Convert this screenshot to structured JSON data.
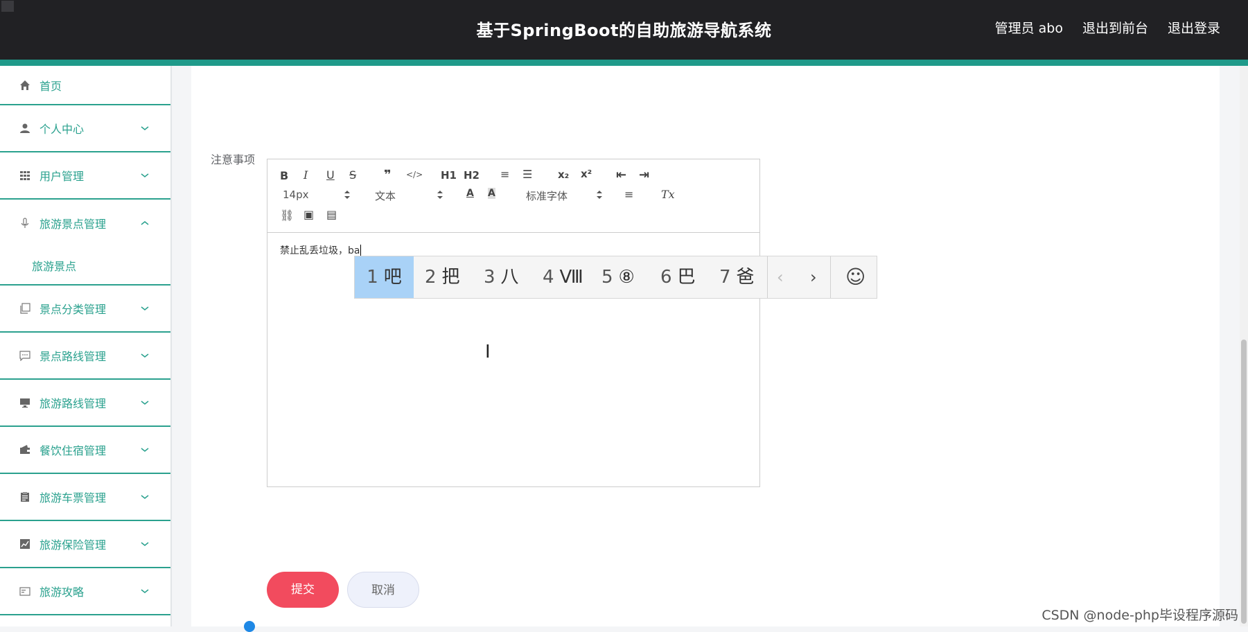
{
  "header": {
    "title": "基于SpringBoot的自助旅游导航系统",
    "links": [
      "管理员 abo",
      "退出到前台",
      "退出登录"
    ],
    "accent_color": "#1f9a8a"
  },
  "sidebar": {
    "items": [
      {
        "label": "首页",
        "icon": "home-icon"
      },
      {
        "label": "个人中心",
        "icon": "user-icon"
      },
      {
        "label": "用户管理",
        "icon": "grid-icon"
      },
      {
        "label": "旅游景点管理",
        "icon": "microphone-icon",
        "expanded": true
      },
      {
        "label": "旅游景点",
        "sub": true
      },
      {
        "label": "景点分类管理",
        "icon": "copy-icon"
      },
      {
        "label": "景点路线管理",
        "icon": "chat-icon"
      },
      {
        "label": "旅游路线管理",
        "icon": "monitor-icon"
      },
      {
        "label": "餐饮住宿管理",
        "icon": "wallet-icon"
      },
      {
        "label": "旅游车票管理",
        "icon": "clipboard-icon"
      },
      {
        "label": "旅游保险管理",
        "icon": "chart-icon"
      },
      {
        "label": "旅游攻略",
        "icon": "card-icon"
      }
    ],
    "color": "#2aa18e"
  },
  "form": {
    "field_label": "注意事项",
    "editor": {
      "toolbar": {
        "bold": "B",
        "italic": "I",
        "underline": "U",
        "strike": "S",
        "blockquote": "❞",
        "code": "</>",
        "h1": "H1",
        "h2": "H2",
        "ordered_list": "≡",
        "bullet_list": "☰",
        "subscript": "x₂",
        "superscript": "x²",
        "outdent": "⇤",
        "indent": "⇥",
        "size": "14px",
        "header_select": "文本",
        "color": "A",
        "background": "A",
        "font": "标准字体",
        "align": "≡",
        "clean": "Tx",
        "link": "⛓",
        "image": "▣",
        "video": "▤"
      },
      "content": "禁止乱丢垃圾，ba"
    },
    "submit_label": "提交",
    "cancel_label": "取消"
  },
  "ime": {
    "candidates": [
      {
        "n": "1",
        "text": "吧"
      },
      {
        "n": "2",
        "text": "把"
      },
      {
        "n": "3",
        "text": "八"
      },
      {
        "n": "4",
        "text": "Ⅷ"
      },
      {
        "n": "5",
        "text": "⑧"
      },
      {
        "n": "6",
        "text": "巴"
      },
      {
        "n": "7",
        "text": "爸"
      }
    ],
    "prev": "‹",
    "next": "›",
    "emoji": "☺"
  },
  "watermark": "CSDN @node-php毕设程序源码"
}
